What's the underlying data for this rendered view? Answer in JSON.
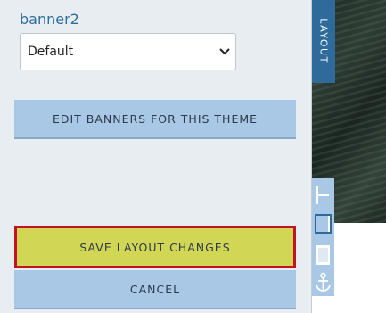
{
  "panel": {
    "field_label": "banner2",
    "select_value": "Default",
    "edit_banners_label": "EDIT BANNERS FOR THIS THEME",
    "save_layout_label": "SAVE LAYOUT CHANGES",
    "cancel_label": "CANCEL"
  },
  "side": {
    "layout_tab_label": "LAYOUT",
    "tools": [
      "align-left-icon",
      "align-center-icon",
      "align-full-icon",
      "anchor-icon"
    ]
  },
  "colors": {
    "accent_blue": "#2e6a9a",
    "button_blue": "#a9c8e6",
    "save_yellow": "#d2d655",
    "highlight_red": "#c11420"
  }
}
